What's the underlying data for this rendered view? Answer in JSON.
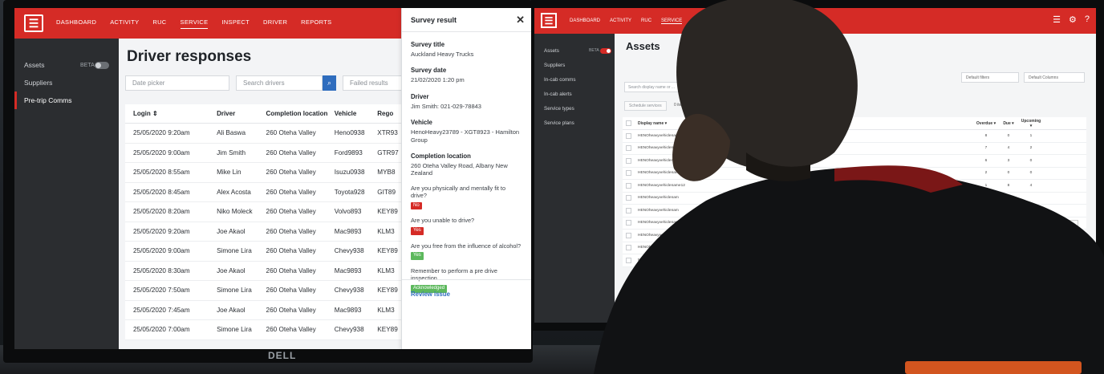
{
  "left_screen": {
    "nav": [
      "DASHBOARD",
      "ACTIVITY",
      "RUC",
      "SERVICE",
      "INSPECT",
      "DRIVER",
      "REPORTS"
    ],
    "active_nav": "SERVICE",
    "sidebar": [
      {
        "label": "Assets",
        "beta": "BETA"
      },
      {
        "label": "Suppliers"
      },
      {
        "label": "Pre-trip Comms"
      }
    ],
    "page_title": "Driver responses",
    "filters": {
      "date_placeholder": "Date picker",
      "search_placeholder": "Search drivers",
      "status": "Failed results"
    },
    "columns": [
      "Login ⇕",
      "Driver",
      "Completion location",
      "Vehicle",
      "Rego"
    ],
    "rows": [
      [
        "25/05/2020  9:20am",
        "Ali Baswa",
        "260 Oteha Valley",
        "Heno0938",
        "XTR93"
      ],
      [
        "25/05/2020  9:00am",
        "Jim Smith",
        "260 Oteha Valley",
        "Ford9893",
        "GTR97"
      ],
      [
        "25/05/2020  8:55am",
        "Mike Lin",
        "260 Oteha Valley",
        "Isuzu0938",
        "MYB8"
      ],
      [
        "25/05/2020  8:45am",
        "Alex Acosta",
        "260 Oteha Valley",
        "Toyota928",
        "GIT89"
      ],
      [
        "25/05/2020  8:20am",
        "Niko Moleck",
        "260 Oteha Valley",
        "Volvo893",
        "KEY89"
      ],
      [
        "25/05/2020  9:20am",
        "Joe Akaol",
        "260 Oteha Valley",
        "Mac9893",
        "KLM3"
      ],
      [
        "25/05/2020  9:00am",
        "Simone Lira",
        "260 Oteha Valley",
        "Chevy938",
        "KEY89"
      ],
      [
        "25/05/2020  8:30am",
        "Joe Akaol",
        "260 Oteha Valley",
        "Mac9893",
        "KLM3"
      ],
      [
        "25/05/2020  7:50am",
        "Simone Lira",
        "260 Oteha Valley",
        "Chevy938",
        "KEY89"
      ],
      [
        "25/05/2020  7:45am",
        "Joe Akaol",
        "260 Oteha Valley",
        "Mac9893",
        "KLM3"
      ],
      [
        "25/05/2020  7:00am",
        "Simone Lira",
        "260 Oteha Valley",
        "Chevy938",
        "KEY89"
      ]
    ],
    "panel": {
      "title": "Survey result",
      "fields": [
        {
          "label": "Survey title",
          "value": "Auckland Heavy Trucks"
        },
        {
          "label": "Survey date",
          "value": "21/02/2020 1:20 pm"
        },
        {
          "label": "Driver",
          "value": "Jim Smith: 021-029-78843"
        },
        {
          "label": "Vehicle",
          "value": "HenoHeavy23789 - XGT8923 - Hamilton Group"
        },
        {
          "label": "Completion location",
          "value": "260 Oteha Valley Road, Albany New Zealand"
        }
      ],
      "questions": [
        {
          "q": "Are you physically and mentally fit to drive?",
          "a": "No",
          "kind": "no"
        },
        {
          "q": "Are you unable to drive?",
          "a": "Yes",
          "kind": "no"
        },
        {
          "q": "Are you free from the influence of alcohol?",
          "a": "Yes",
          "kind": "yes"
        },
        {
          "q": "Remember to perform a pre drive inspection",
          "a": "Acknowledged",
          "kind": "yes"
        }
      ],
      "review_link": "Review issue"
    },
    "brand": "DELL"
  },
  "right_screen": {
    "nav": [
      "DASHBOARD",
      "ACTIVITY",
      "RUC",
      "SERVICE"
    ],
    "sidebar": [
      "Assets",
      "Suppliers",
      "In-cab comms",
      "In-cab alerts",
      "Service types",
      "Service plans"
    ],
    "beta": "BETA",
    "page_title": "Assets",
    "search_placeholder": "Search display name or ...",
    "schedule_button": "Schedule services",
    "count": "0 items",
    "default_filters": "Default filters",
    "default_columns": "Default Columns",
    "columns": [
      "Display name ▾",
      "Overdue ▾",
      "Due ▾",
      "Upcoming ▾"
    ],
    "rows": [
      [
        "HENOheavyvehiclename123",
        "8",
        "0",
        "1"
      ],
      [
        "HENOheavyvehiclename123",
        "7",
        "4",
        "2"
      ],
      [
        "HENOheavyvehiclename123",
        "6",
        "3",
        "0"
      ],
      [
        "HENOheavyvehiclename123",
        "2",
        "0",
        "0"
      ],
      [
        "HENOheavyvehiclename12",
        "1",
        "8",
        "4"
      ],
      [
        "HENOheavyvehiclenam",
        "",
        "",
        ""
      ],
      [
        "HENOheavyvehiclenam",
        "",
        "",
        ""
      ],
      [
        "HENOheavyvehiclenam",
        "",
        "",
        ""
      ],
      [
        "HENOheavyvehiclenam",
        "",
        "",
        ""
      ],
      [
        "HENOheavyvehiclenam",
        "",
        "",
        ""
      ],
      [
        "Newly Added Ve",
        "",
        "",
        ""
      ]
    ]
  },
  "colors": {
    "brand_red": "#d52b26",
    "link_blue": "#2f6dbe",
    "sidebar_dark": "#2b2d30"
  }
}
